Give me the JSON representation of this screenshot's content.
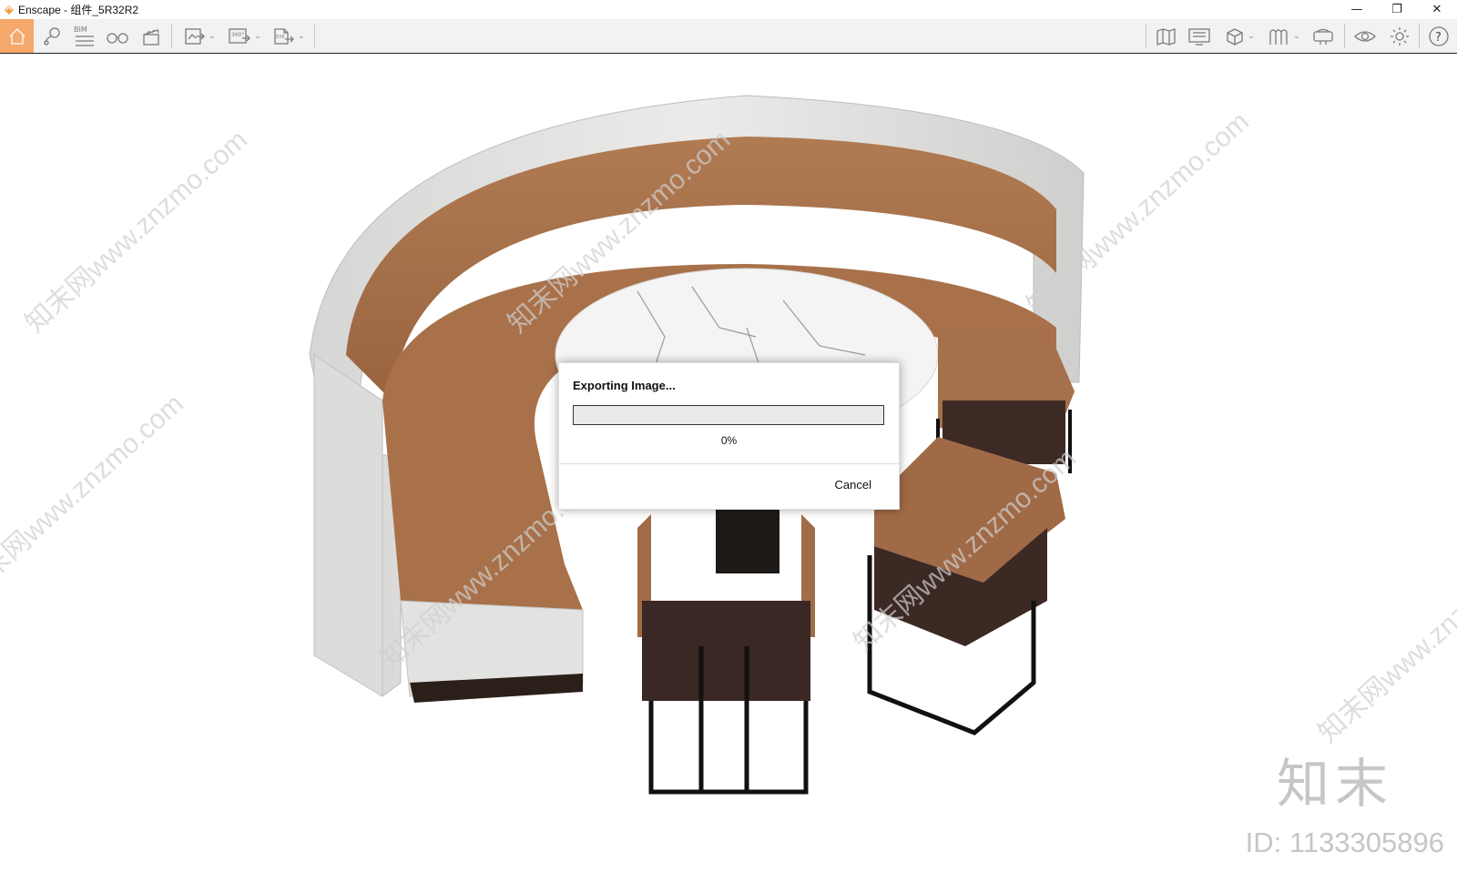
{
  "window": {
    "title": "Enscape - 组件_5R32R2",
    "controls": {
      "minimize": "—",
      "restore": "❐",
      "close": "✕"
    }
  },
  "toolbar": {
    "left_icons": [
      "home-icon",
      "map-pin-icon",
      "bim-icon",
      "binoculars-icon",
      "clapperboard-icon",
      "export-image-icon",
      "export-360-icon",
      "export-exe-icon"
    ],
    "bim_label": "BIM",
    "pano_label": "360°",
    "exe_label": "EXE",
    "right_icons": [
      "map-icon",
      "monitor-icon",
      "cube-icon",
      "asset-library-icon",
      "vr-headset-icon",
      "eye-icon",
      "gear-icon",
      "help-icon"
    ],
    "help_label": "?",
    "accent_color": "#f5a96c"
  },
  "viewport": {
    "watermark_text": "知末网www.znzmo.com",
    "brand": "知末",
    "id_text": "ID: 1133305896"
  },
  "dialog": {
    "title": "Exporting Image...",
    "progress": 0,
    "progress_label": "0%",
    "cancel_label": "Cancel"
  }
}
